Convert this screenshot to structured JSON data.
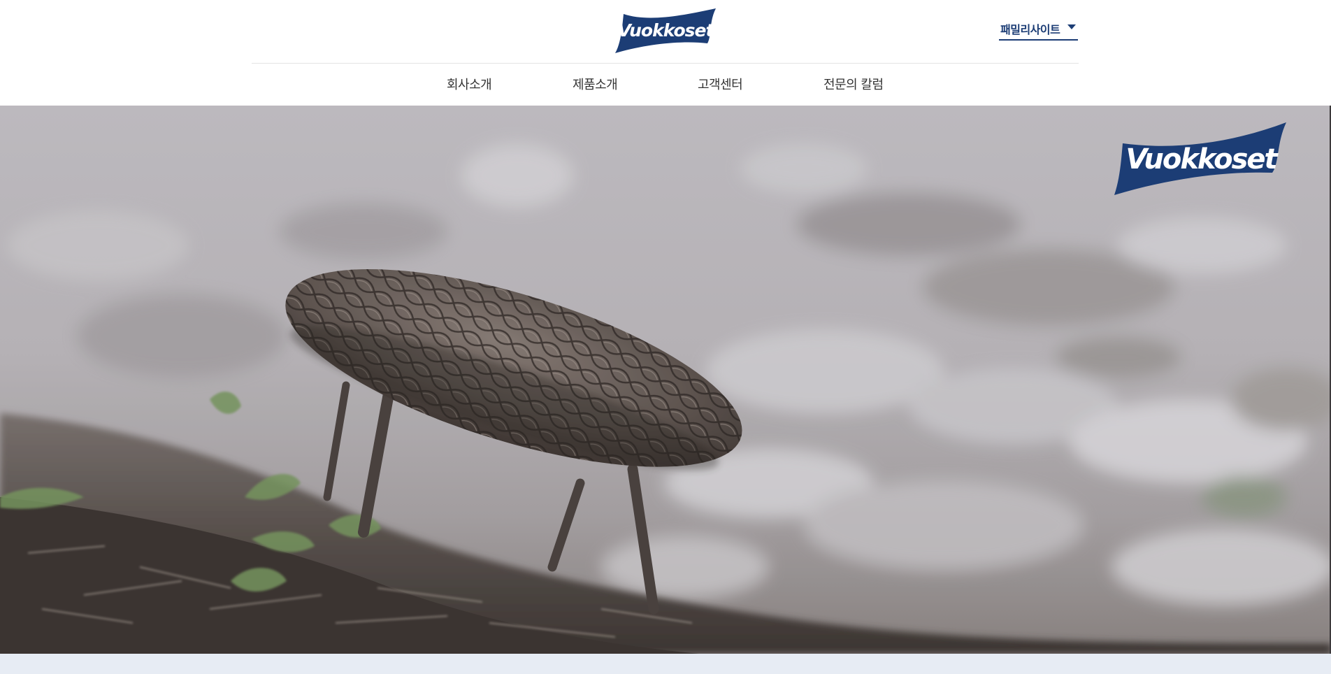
{
  "brand": {
    "name": "Vuokkoset",
    "primary_color": "#1c3d75",
    "logo_text_color": "#ffffff"
  },
  "header": {
    "logo_icon": "vuokkoset-logo",
    "family_site": {
      "label": "패밀리사이트",
      "icon": "caret-down-icon"
    }
  },
  "nav": {
    "items": [
      {
        "label": "회사소개"
      },
      {
        "label": "제품소개"
      },
      {
        "label": "고객센터"
      },
      {
        "label": "전문의 칼럼"
      }
    ]
  },
  "hero": {
    "image": "pinecone-on-forest-floor",
    "logo_icon": "vuokkoset-logo"
  }
}
